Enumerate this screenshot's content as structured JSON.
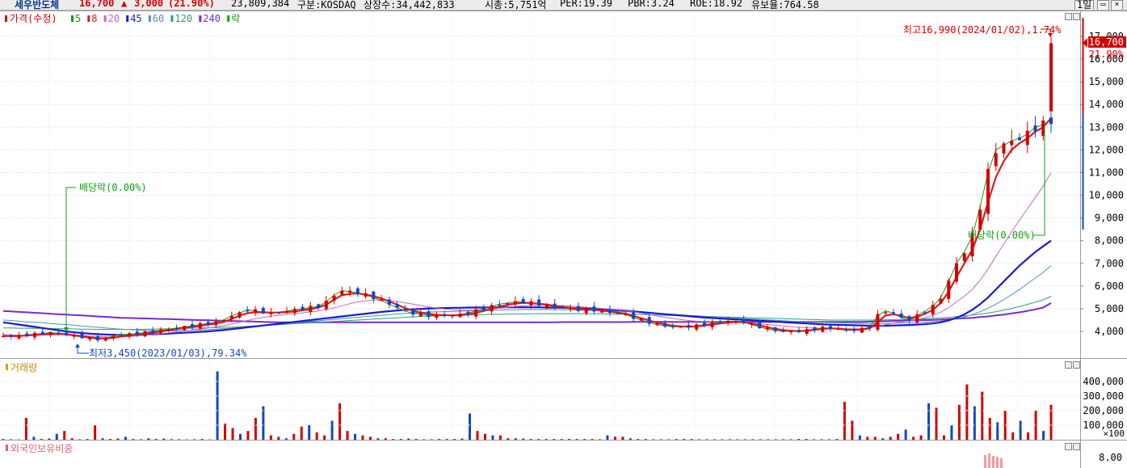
{
  "header": {
    "name": "세우반도체",
    "price": "16,700",
    "change_arrow": "▲",
    "change": "3,000",
    "change_pct": "(21.90%)",
    "volume": "23,809,384",
    "market": "구분:KOSDAQ",
    "shares": "상장수:34,442,833",
    "mcap": "시총:5,751억",
    "per": "PER:19.39",
    "pbr": "PBR:3.24",
    "roe": "ROE:18.92",
    "float_rate": "유보율:764.58",
    "period_button": "1일",
    "colors": {
      "up": "#d40000",
      "down": "#1048c8"
    }
  },
  "legend": {
    "price_label": "가격(수정)",
    "ma": [
      {
        "label": "5",
        "color": "#11a011"
      },
      {
        "label": "8",
        "color": "#e21a1a"
      },
      {
        "label": "20",
        "color": "#c069c0"
      },
      {
        "label": "45",
        "color": "#1a1ad0"
      },
      {
        "label": "60",
        "color": "#4f8fbf"
      },
      {
        "label": "120",
        "color": "#2aa07a"
      },
      {
        "label": "240",
        "color": "#7a2ad0"
      }
    ],
    "drop_label": "락"
  },
  "annotations": {
    "dividend1": "배당락(0.00%)",
    "dividend2": "배당락(0.00%)",
    "high": "최고16,990(2024/01/02),1.74%",
    "low": "최저3,450(2023/01/03),79.34%"
  },
  "price_axis": {
    "ticks": [
      "17,000",
      "16,000",
      "15,000",
      "14,000",
      "13,000",
      "12,000",
      "11,000",
      "10,000",
      "9,000",
      "8,000",
      "7,000",
      "6,000",
      "5,000",
      "4,000"
    ],
    "current_price": "16,700",
    "current_pct": "21.90%"
  },
  "volume_panel": {
    "title": "거래량",
    "ticks": [
      "400,000",
      "300,000",
      "200,000",
      "100,000"
    ],
    "unit": "×100"
  },
  "foreign_panel": {
    "title": "외국인보유비중",
    "ticks": [
      "8.00"
    ]
  },
  "chart_data": {
    "type": "candlestick",
    "title": "",
    "price_range": [
      3450,
      16990
    ],
    "ylim": [
      3300,
      17500
    ],
    "volume_ylim": [
      0,
      470000
    ],
    "series": [
      {
        "name": "5",
        "values": [
          3800,
          3780,
          3800,
          3850,
          3880,
          3900,
          3950,
          3900,
          3850,
          3800,
          3750,
          3700,
          3650,
          3700,
          3800,
          3850,
          3880,
          3900,
          3950,
          4000,
          4050,
          4100,
          4150,
          4200,
          4250,
          4300,
          4350,
          4400,
          4500,
          4700,
          4800,
          4950,
          4900,
          4850,
          4800,
          4850,
          4900,
          4950,
          5000,
          5050,
          5100,
          5300,
          5600,
          5800,
          5750,
          5700,
          5600,
          5500,
          5350,
          5200,
          5050,
          4900,
          4800,
          4750,
          4700,
          4700,
          4700,
          4700,
          4750,
          4800,
          4900,
          5000,
          5100,
          5200,
          5250,
          5300,
          5300,
          5250,
          5200,
          5150,
          5100,
          5050,
          5000,
          4950,
          4950,
          4950,
          4900,
          4850,
          4800,
          4750,
          4600,
          4500,
          4400,
          4300,
          4250,
          4200,
          4200,
          4200,
          4250,
          4300,
          4350,
          4400,
          4450,
          4450,
          4400,
          4300,
          4200,
          4100,
          4050,
          4000,
          4000,
          4000,
          4050,
          4100,
          4150,
          4150,
          4100,
          4050,
          4050,
          4100,
          4200,
          4700,
          4900,
          4800,
          4600,
          4500,
          4700,
          4900,
          5100,
          5500,
          6200,
          7000,
          7500,
          8200,
          9500,
          11000,
          12000,
          12200,
          12400,
          12500,
          12700,
          13000,
          13100,
          13300
        ]
      },
      {
        "name": "8",
        "values": [
          3800,
          3790,
          3800,
          3820,
          3850,
          3880,
          3900,
          3900,
          3880,
          3830,
          3790,
          3740,
          3700,
          3690,
          3720,
          3780,
          3820,
          3860,
          3900,
          3950,
          4000,
          4050,
          4100,
          4150,
          4200,
          4250,
          4300,
          4350,
          4420,
          4550,
          4700,
          4800,
          4850,
          4840,
          4830,
          4830,
          4850,
          4880,
          4930,
          4980,
          5050,
          5180,
          5400,
          5600,
          5650,
          5680,
          5620,
          5560,
          5450,
          5320,
          5180,
          5030,
          4910,
          4830,
          4770,
          4730,
          4720,
          4710,
          4720,
          4750,
          4820,
          4900,
          5000,
          5090,
          5170,
          5230,
          5260,
          5250,
          5220,
          5180,
          5130,
          5080,
          5040,
          5000,
          4970,
          4960,
          4920,
          4880,
          4830,
          4780,
          4680,
          4580,
          4480,
          4380,
          4310,
          4250,
          4220,
          4210,
          4220,
          4260,
          4300,
          4350,
          4390,
          4420,
          4410,
          4350,
          4270,
          4180,
          4110,
          4060,
          4030,
          4010,
          4030,
          4070,
          4110,
          4130,
          4120,
          4090,
          4070,
          4080,
          4140,
          4420,
          4700,
          4760,
          4680,
          4590,
          4640,
          4780,
          4950,
          5250,
          5750,
          6400,
          7000,
          7600,
          8500,
          9700,
          10800,
          11500,
          12000,
          12300,
          12500,
          12800,
          13000,
          13400
        ]
      },
      {
        "name": "20",
        "values": [
          3850,
          3840,
          3830,
          3820,
          3820,
          3830,
          3840,
          3850,
          3850,
          3840,
          3820,
          3800,
          3780,
          3760,
          3750,
          3760,
          3780,
          3800,
          3830,
          3860,
          3900,
          3940,
          3980,
          4020,
          4060,
          4100,
          4150,
          4200,
          4250,
          4320,
          4400,
          4480,
          4560,
          4620,
          4670,
          4710,
          4750,
          4780,
          4820,
          4860,
          4900,
          4960,
          5040,
          5130,
          5220,
          5300,
          5350,
          5380,
          5380,
          5360,
          5320,
          5260,
          5200,
          5140,
          5080,
          5030,
          4990,
          4960,
          4940,
          4930,
          4940,
          4960,
          4990,
          5020,
          5060,
          5100,
          5130,
          5150,
          5160,
          5160,
          5150,
          5130,
          5110,
          5090,
          5060,
          5040,
          5010,
          4980,
          4950,
          4910,
          4860,
          4800,
          4740,
          4680,
          4620,
          4570,
          4520,
          4480,
          4450,
          4430,
          4410,
          4400,
          4390,
          4390,
          4380,
          4360,
          4330,
          4300,
          4270,
          4240,
          4210,
          4180,
          4160,
          4150,
          4140,
          4130,
          4120,
          4110,
          4110,
          4120,
          4150,
          4220,
          4300,
          4370,
          4420,
          4460,
          4520,
          4600,
          4700,
          4850,
          5050,
          5300,
          5550,
          5850,
          6250,
          6750,
          7300,
          7850,
          8400,
          8900,
          9400,
          9900,
          10400,
          11000
        ]
      },
      {
        "name": "45",
        "values": [
          4400,
          4350,
          4300,
          4250,
          4200,
          4150,
          4100,
          4050,
          4000,
          3960,
          3930,
          3900,
          3880,
          3860,
          3850,
          3840,
          3840,
          3850,
          3860,
          3870,
          3890,
          3900,
          3920,
          3940,
          3960,
          3980,
          4000,
          4030,
          4060,
          4100,
          4140,
          4180,
          4220,
          4260,
          4300,
          4340,
          4380,
          4420,
          4460,
          4500,
          4540,
          4580,
          4620,
          4660,
          4700,
          4740,
          4780,
          4820,
          4860,
          4890,
          4920,
          4950,
          4970,
          4990,
          5010,
          5020,
          5030,
          5040,
          5040,
          5050,
          5050,
          5050,
          5060,
          5060,
          5060,
          5060,
          5060,
          5060,
          5060,
          5050,
          5050,
          5040,
          5030,
          5020,
          5010,
          5000,
          4980,
          4960,
          4940,
          4910,
          4880,
          4850,
          4820,
          4790,
          4760,
          4730,
          4700,
          4670,
          4640,
          4610,
          4590,
          4570,
          4550,
          4530,
          4510,
          4490,
          4470,
          4450,
          4430,
          4410,
          4390,
          4370,
          4350,
          4330,
          4310,
          4300,
          4290,
          4280,
          4270,
          4260,
          4250,
          4250,
          4250,
          4260,
          4270,
          4280,
          4300,
          4320,
          4350,
          4400,
          4480,
          4600,
          4750,
          4950,
          5200,
          5500,
          5850,
          6200,
          6550,
          6900,
          7200,
          7500,
          7750,
          8000
        ]
      },
      {
        "name": "60",
        "values": [
          4500,
          4480,
          4450,
          4420,
          4400,
          4380,
          4350,
          4320,
          4300,
          4270,
          4240,
          4210,
          4180,
          4150,
          4120,
          4100,
          4080,
          4060,
          4050,
          4040,
          4030,
          4030,
          4030,
          4040,
          4050,
          4060,
          4080,
          4100,
          4120,
          4140,
          4170,
          4200,
          4230,
          4260,
          4290,
          4320,
          4350,
          4380,
          4410,
          4440,
          4470,
          4500,
          4530,
          4560,
          4590,
          4620,
          4650,
          4680,
          4710,
          4740,
          4770,
          4790,
          4810,
          4830,
          4850,
          4860,
          4870,
          4880,
          4890,
          4900,
          4910,
          4920,
          4930,
          4940,
          4950,
          4950,
          4960,
          4960,
          4960,
          4960,
          4960,
          4950,
          4950,
          4940,
          4930,
          4920,
          4910,
          4900,
          4890,
          4870,
          4850,
          4830,
          4810,
          4790,
          4770,
          4750,
          4730,
          4710,
          4690,
          4670,
          4650,
          4630,
          4610,
          4590,
          4570,
          4550,
          4530,
          4510,
          4490,
          4470,
          4450,
          4430,
          4420,
          4410,
          4400,
          4390,
          4380,
          4370,
          4360,
          4350,
          4350,
          4350,
          4350,
          4360,
          4370,
          4380,
          4390,
          4410,
          4430,
          4460,
          4500,
          4560,
          4640,
          4740,
          4870,
          5020,
          5200,
          5400,
          5620,
          5850,
          6100,
          6350,
          6600,
          6900
        ]
      },
      {
        "name": "120",
        "values": [
          4150,
          4150,
          4140,
          4140,
          4130,
          4130,
          4120,
          4120,
          4110,
          4110,
          4100,
          4100,
          4090,
          4090,
          4090,
          4090,
          4090,
          4090,
          4100,
          4100,
          4110,
          4110,
          4120,
          4130,
          4140,
          4150,
          4160,
          4170,
          4180,
          4190,
          4200,
          4220,
          4240,
          4260,
          4280,
          4300,
          4320,
          4340,
          4360,
          4380,
          4400,
          4420,
          4440,
          4460,
          4480,
          4500,
          4520,
          4540,
          4560,
          4580,
          4600,
          4620,
          4640,
          4660,
          4670,
          4680,
          4690,
          4700,
          4710,
          4720,
          4730,
          4740,
          4750,
          4760,
          4760,
          4770,
          4770,
          4780,
          4780,
          4780,
          4780,
          4780,
          4780,
          4780,
          4780,
          4780,
          4770,
          4770,
          4760,
          4760,
          4750,
          4740,
          4730,
          4720,
          4710,
          4700,
          4690,
          4680,
          4670,
          4660,
          4650,
          4640,
          4630,
          4620,
          4610,
          4600,
          4590,
          4580,
          4570,
          4560,
          4550,
          4540,
          4530,
          4520,
          4510,
          4500,
          4500,
          4500,
          4500,
          4500,
          4500,
          4500,
          4510,
          4520,
          4530,
          4540,
          4550,
          4560,
          4580,
          4600,
          4620,
          4650,
          4680,
          4720,
          4760,
          4810,
          4870,
          4940,
          5010,
          5100,
          5190,
          5290,
          5390,
          5550
        ]
      },
      {
        "name": "240",
        "values": [
          4900,
          4880,
          4860,
          4840,
          4820,
          4800,
          4780,
          4760,
          4740,
          4720,
          4700,
          4680,
          4660,
          4640,
          4620,
          4600,
          4590,
          4580,
          4570,
          4560,
          4550,
          4540,
          4530,
          4520,
          4510,
          4500,
          4490,
          4480,
          4470,
          4460,
          4450,
          4440,
          4430,
          4420,
          4410,
          4400,
          4400,
          4400,
          4400,
          4400,
          4400,
          4400,
          4400,
          4400,
          4400,
          4400,
          4400,
          4400,
          4400,
          4400,
          4400,
          4400,
          4400,
          4400,
          4400,
          4400,
          4400,
          4400,
          4400,
          4400,
          4400,
          4400,
          4400,
          4400,
          4400,
          4400,
          4400,
          4400,
          4400,
          4400,
          4400,
          4410,
          4410,
          4410,
          4410,
          4410,
          4410,
          4410,
          4410,
          4410,
          4420,
          4420,
          4420,
          4420,
          4420,
          4420,
          4420,
          4420,
          4420,
          4420,
          4420,
          4420,
          4420,
          4420,
          4420,
          4420,
          4420,
          4420,
          4420,
          4420,
          4420,
          4420,
          4420,
          4420,
          4420,
          4420,
          4420,
          4420,
          4420,
          4420,
          4430,
          4440,
          4450,
          4460,
          4470,
          4480,
          4490,
          4500,
          4510,
          4520,
          4540,
          4560,
          4580,
          4600,
          4630,
          4660,
          4700,
          4740,
          4790,
          4840,
          4900,
          4970,
          5050,
          5250
        ]
      }
    ],
    "candles": {
      "highs": [
        17000,
        16990,
        14400,
        13600,
        13900
      ],
      "last": {
        "open": 13700,
        "high": 16990,
        "low": 13700,
        "close": 16700
      }
    },
    "volume_values": [
      5000,
      3000,
      2000,
      150000,
      20000,
      5000,
      8000,
      40000,
      60000,
      10000,
      3000,
      5000,
      100000,
      10000,
      5000,
      8000,
      20000,
      5000,
      3000,
      10000,
      5000,
      8000,
      4000,
      3000,
      2000,
      3000,
      5000,
      2000,
      470000,
      110000,
      80000,
      40000,
      60000,
      150000,
      230000,
      30000,
      20000,
      10000,
      40000,
      90000,
      100000,
      50000,
      30000,
      130000,
      250000,
      60000,
      40000,
      30000,
      20000,
      10000,
      10000,
      5000,
      5000,
      8000,
      5000,
      3000,
      3000,
      5000,
      5000,
      5000,
      8000,
      180000,
      60000,
      40000,
      30000,
      30000,
      10000,
      10000,
      8000,
      5000,
      5000,
      5000,
      5000,
      5000,
      5000,
      5000,
      5000,
      5000,
      3000,
      30000,
      20000,
      20000,
      10000,
      5000,
      5000,
      3000,
      3000,
      3000,
      5000,
      5000,
      5000,
      3000,
      3000,
      3000,
      3000,
      3000,
      3000,
      3000,
      3000,
      3000,
      3000,
      3000,
      3000,
      3000,
      5000,
      5000,
      3000,
      3000,
      3000,
      5000,
      260000,
      130000,
      30000,
      20000,
      20000,
      10000,
      20000,
      40000,
      70000,
      20000,
      30000,
      250000,
      220000,
      30000,
      100000,
      240000,
      380000,
      230000,
      330000,
      150000,
      120000,
      200000,
      50000,
      130000,
      50000,
      200000,
      60000,
      240000
    ]
  }
}
